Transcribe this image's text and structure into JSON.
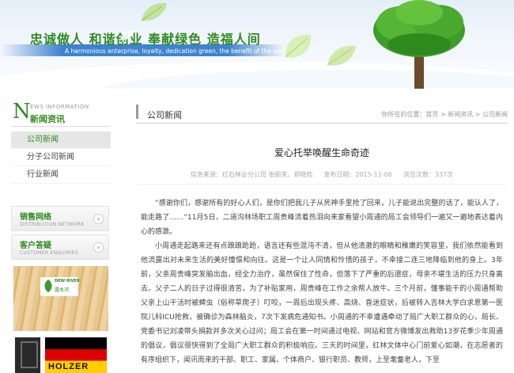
{
  "banner": {
    "slogan_cn": "忠诚做人  和谐创业  奉献绿色  造福人间",
    "slogan_en": "A harmonious enterprise, loyalty, dedication green, the benefit of the world"
  },
  "sidebar": {
    "head_letter": "N",
    "head_en": "EWS INFORMATION",
    "head_cn": "新闻资讯",
    "items": [
      {
        "label": "公司新闻"
      },
      {
        "label": "分子公司新闻"
      },
      {
        "label": "行业新闻"
      }
    ],
    "boxes": [
      {
        "title": "销售网络",
        "subtitle": "DISTRIBUTION NETWORK"
      },
      {
        "title": "客户答疑",
        "subtitle": "CUSTOMER ENQUIRIES"
      }
    ],
    "ad1": {
      "brand_en": "DEW RIVER",
      "brand_cn": "露水河"
    },
    "ad2": {
      "brand": "HOLZER"
    },
    "arrow_glyph": "»",
    "colors": {
      "accent_green": "#2f8a1e"
    }
  },
  "main": {
    "section_title": "公司新闻",
    "breadcrumb": {
      "prefix": "你所在的位置：",
      "items": [
        "首页",
        "新闻资讯",
        "公司新闻"
      ],
      "separator": " > "
    },
    "article": {
      "title": "爱心托举唤醒生命奇迹",
      "source": "信息来源：红石林业分公司 张丽荣、郑晓皓",
      "published": "发布日期：2015-11-06",
      "views": "浏览次数：337次",
      "paragraphs": [
        "“感谢你们，感谢所有的好心人们，是你们把我儿子从死神手里抢了回来，儿子能说出完整的话了，能认人了，能走路了……”11月5日，二道沟林场职工周贵峰流着热泪向来家看望小周通的局工会领导们一遍又一遍地表达着内心的感激。",
        "小周通走起路来还有点踉踉跄跄，语言还有些混沌不清，但从他清澈的眼睛和稚嫩的笑容里，我们依然能看到他流露出对未来生活的美好憧憬和向往。这是一个让人同情和怜惜的孩子，不幸接二连三地降临到他的身上。3年前，父亲周贵峰突发脑出血，经全力治疗，虽然保住了性命，但落下了严重的后遗症，母亲不堪生活的压力只身离去。父子二人的日子过得很清苦，为了补贴家用，周贵峰在工作之余帮人放牛。三个月前，懂事能干的小周通帮助父亲上山干活时被蜱虫（俗称草爬子）叮咬，一周后出现头疼、高烧、昏迷症状，后被转入吉林大学白求恩第一医院儿科ICU抢救，被确诊为森林脑炎，7次下发病危通知书。小周通的不幸遭遇牵动了局广大职工群众的心，局长、党委书记刘凌带头捐款并多次关心过问；局工会在第一时间通过电视、网站和官方微博发出救助13岁花季少年周通的倡议，倡议很快得到了全局广大职工群众的积极响应。三天的时间里，红林文体中心门前爱心如潮，在志愿者的有序组织下，闻讯而来的干部、职工、家属、个体商户、银行职员、教师，上至耄耋老人，下至"
      ]
    }
  }
}
